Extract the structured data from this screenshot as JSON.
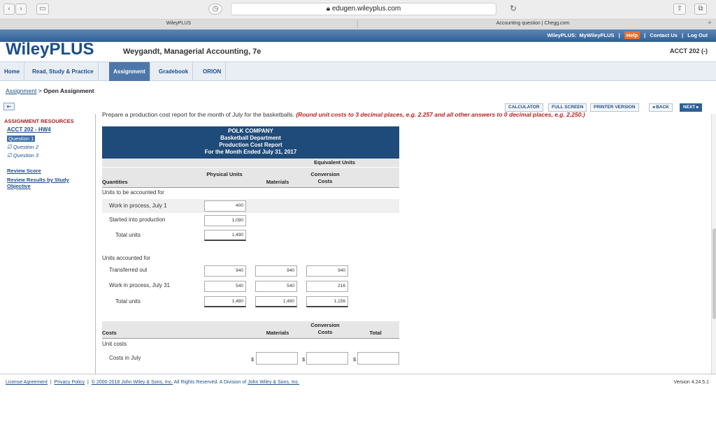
{
  "browser": {
    "url": "edugen.wileyplus.com",
    "tab_left": "WileyPLUS",
    "tab_right": "Accounting question | Chegg.com"
  },
  "top_links": {
    "brand": "WileyPLUS:",
    "my": "MyWileyPLUS",
    "help": "Help",
    "contact": "Contact Us",
    "logout": "Log Out"
  },
  "header": {
    "logo": "WileyPLUS",
    "book": "Weygandt, Managerial Accounting, 7e",
    "course": "ACCT 202 (-)"
  },
  "nav": [
    "Home",
    "Read, Study & Practice",
    "Assignment",
    "Gradebook",
    "ORION"
  ],
  "breadcrumb": {
    "link": "Assignment",
    "sep": ">",
    "current": "Open Assignment"
  },
  "toolbar": {
    "calculator": "CALCULATOR",
    "full_screen": "FULL SCREEN",
    "printer": "PRINTER VERSION",
    "back": "◂ BACK",
    "next": "NEXT ▸"
  },
  "sidebar": {
    "heading": "ASSIGNMENT RESOURCES",
    "course": "ACCT 202 - HW4",
    "questions": [
      "Question 1",
      "Question 2",
      "Question 3"
    ],
    "review_score": "Review Score",
    "review_results": "Review Results by Study Objective"
  },
  "instructions": {
    "text": "Prepare a production cost report for the month of July for the basketballs. ",
    "red": "(Round unit costs to 3 decimal places, e.g. 2.257 and all other answers to 0 decimal places, e.g. 2,250.)"
  },
  "report": {
    "company": "POLK COMPANY",
    "dept": "Basketball Department",
    "title": "Production Cost Report",
    "period": "For the Month Ended July 31, 2017",
    "equiv": "Equivalent Units",
    "col_quantities": "Quantities",
    "col_physical": "Physical Units",
    "col_materials": "Materials",
    "col_conversion": "Conversion Costs",
    "units_to_account": "Units to be accounted for",
    "wip_july1": "Work in process, July 1",
    "started": "Started into production",
    "total_units": "Total units",
    "units_accounted": "Units accounted for",
    "transferred": "Transferred out",
    "wip_july31": "Work in process, July 31",
    "total_units2": "Total units",
    "values": {
      "wip1_phys": "400",
      "started_phys": "1,090",
      "total_phys": "1,490",
      "trans_phys": "940",
      "trans_mat": "940",
      "trans_conv": "940",
      "wip31_phys": "540",
      "wip31_mat": "540",
      "wip31_conv": "216",
      "tot_phys": "1,480",
      "tot_mat": "1,480",
      "tot_conv": "1,156"
    },
    "costs": "Costs",
    "col_materials2": "Materials",
    "col_conversion2": "Conversion Costs",
    "col_total": "Total",
    "unit_costs": "Unit costs",
    "costs_july": "Costs in July",
    "dollar": "$"
  },
  "footer": {
    "license": "License Agreement",
    "privacy": "Privacy Policy",
    "copyright": "© 2000-2018 John Wiley & Sons, Inc.",
    "rights": "All Rights Reserved. A Division of",
    "wiley": "John Wiley & Sons, Inc.",
    "version": "Version 4.24.5.1"
  }
}
